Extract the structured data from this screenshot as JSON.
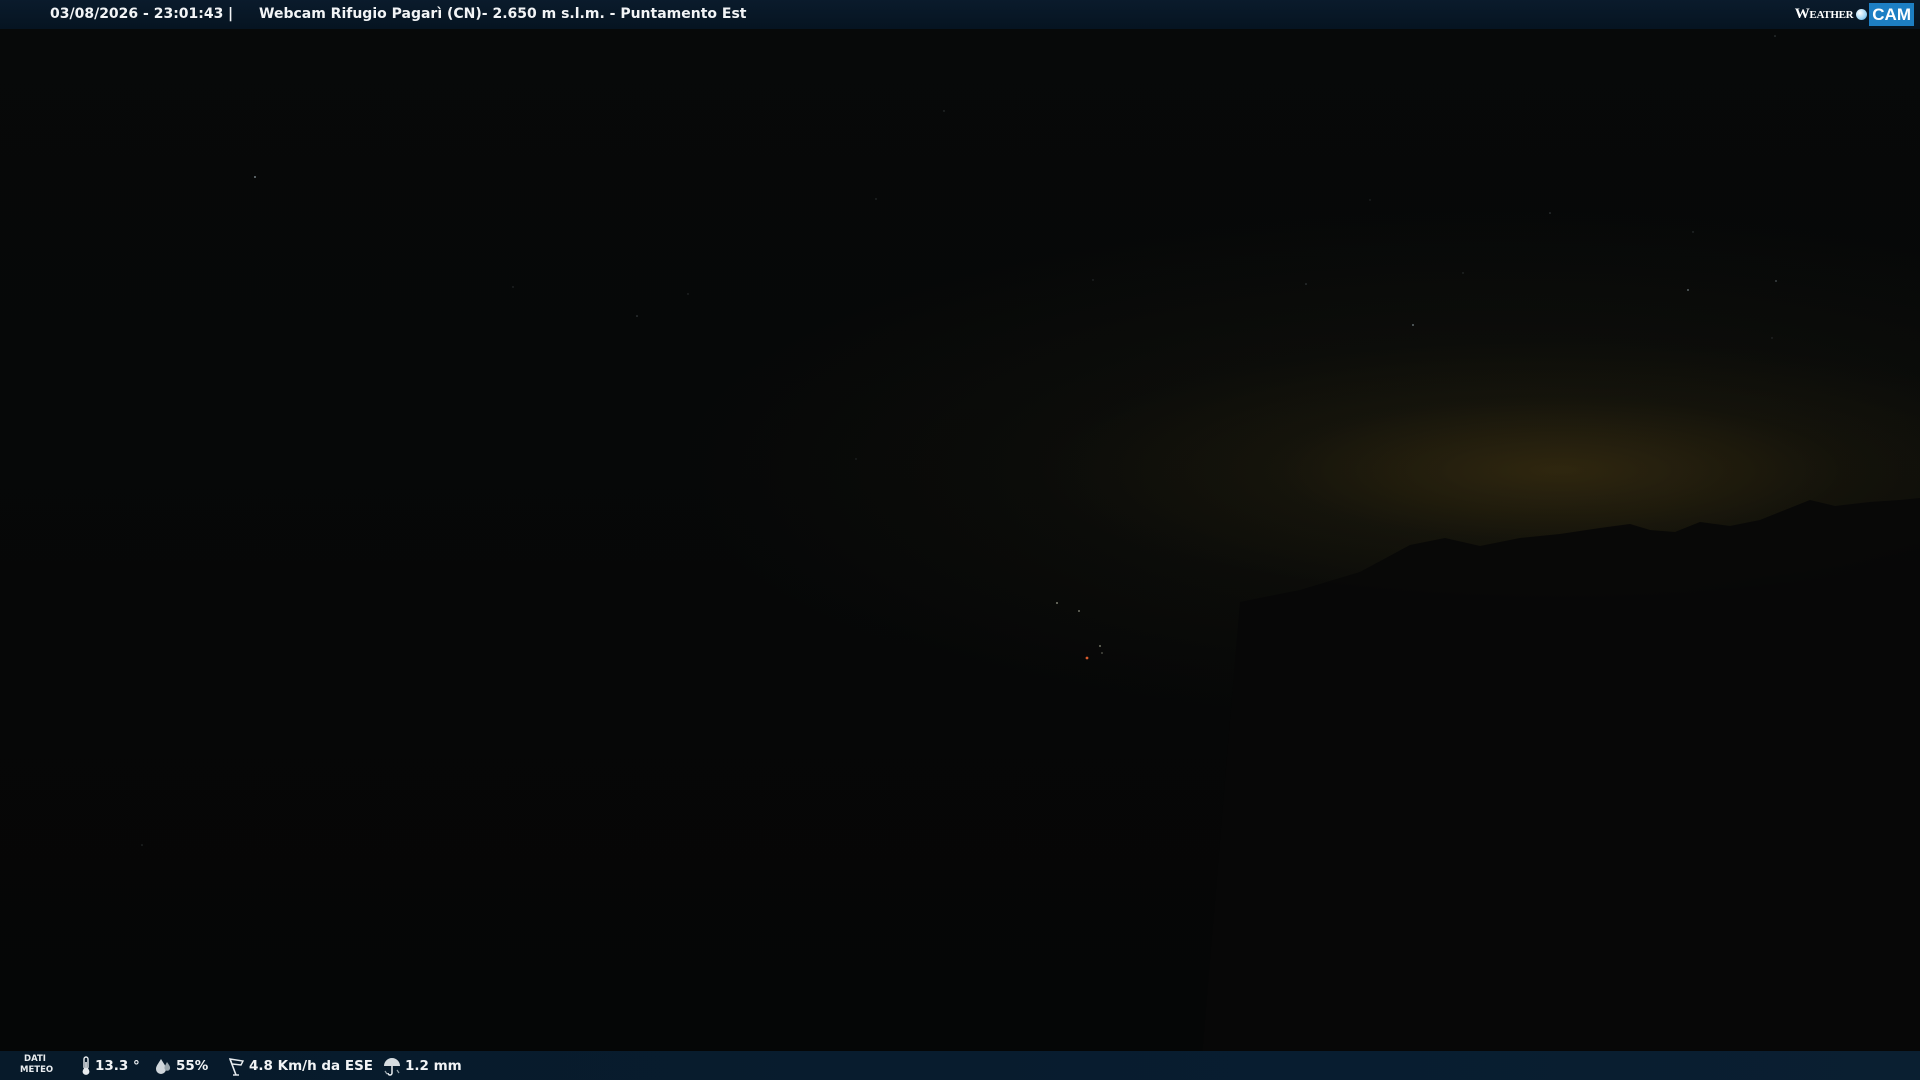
{
  "caption": {
    "datetime": "03/08/2026 - 23:01:43",
    "separator": "|",
    "title": "Webcam Rifugio Pagarì (CN)- 2.650 m s.l.m. - Puntamento Est"
  },
  "brand": {
    "part1": "Weather",
    "part2": "CAM",
    "dot_icon": "globe-dot-icon"
  },
  "weather": {
    "label_line1": "DATI",
    "label_line2": "METEO",
    "temperature": {
      "icon": "thermometer-icon",
      "value": "13.3 °"
    },
    "humidity": {
      "icon": "humidity-drop-icon",
      "value": "55%"
    },
    "wind": {
      "icon": "wind-vane-icon",
      "value": "4.8 Km/h da ESE"
    },
    "rain": {
      "icon": "umbrella-icon",
      "value": "1.2 mm"
    }
  },
  "colors": {
    "bar_background": "#061421",
    "text": "#f2f4f6",
    "brand_accent": "#1d7fc4",
    "sky": "#060707",
    "horizon_glow": "#483812"
  }
}
